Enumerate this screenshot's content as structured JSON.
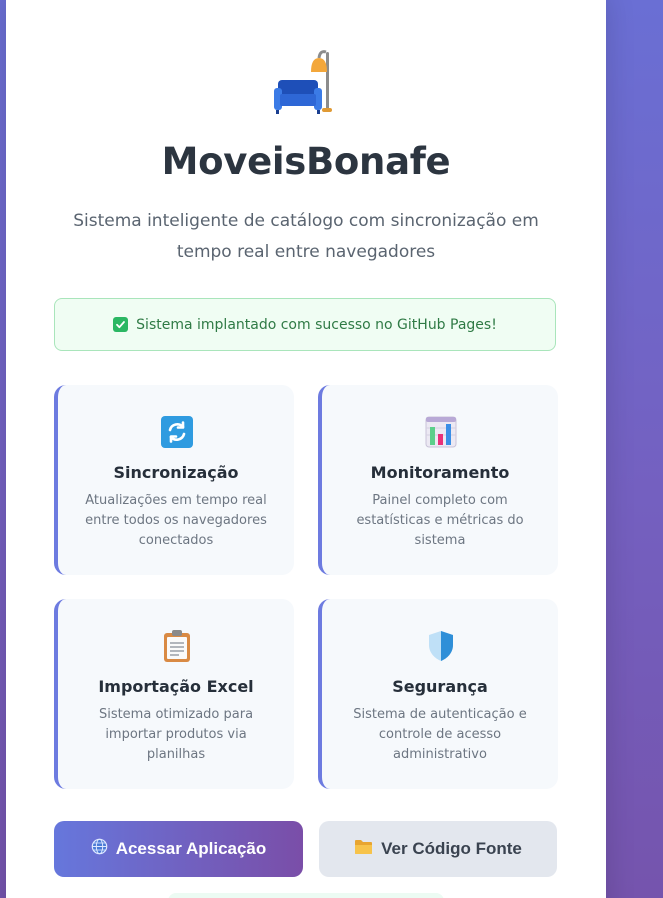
{
  "app": {
    "title": "MoveisBonafe",
    "subtitle": "Sistema inteligente de catálogo com sincronização em tempo real entre navegadores",
    "hero_icon": "sofa-lamp-icon"
  },
  "status": {
    "icon": "check-icon",
    "text": "Sistema implantado com sucesso no GitHub Pages!"
  },
  "features": [
    {
      "icon": "sync-icon",
      "title": "Sincronização",
      "description": "Atualizações em tempo real entre todos os navegadores conectados"
    },
    {
      "icon": "bar-chart-icon",
      "title": "Monitoramento",
      "description": "Painel completo com estatísticas e métricas do sistema"
    },
    {
      "icon": "clipboard-icon",
      "title": "Importação Excel",
      "description": "Sistema otimizado para importar produtos via planilhas"
    },
    {
      "icon": "shield-icon",
      "title": "Segurança",
      "description": "Sistema de autenticação e controle de acesso administrativo"
    }
  ],
  "actions": {
    "primary_label": "Acessar Aplicação",
    "primary_icon": "globe-icon",
    "secondary_label": "Ver Código Fonte",
    "secondary_icon": "folder-icon"
  },
  "colors": {
    "background_gradient_start": "#6a6fd4",
    "background_gradient_end": "#7554ad",
    "accent": "#6d7be0",
    "success": "#2bb763",
    "title_text": "#2c3540"
  }
}
